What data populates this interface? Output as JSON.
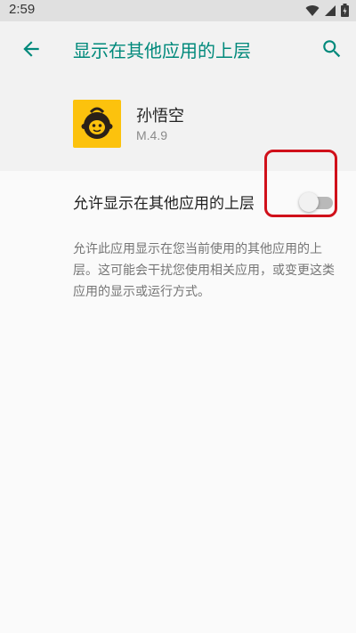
{
  "status_bar": {
    "time": "2:59",
    "icons": [
      "wifi-icon",
      "signal-icon",
      "battery-icon"
    ]
  },
  "app_bar": {
    "title": "显示在其他应用的上层",
    "back_icon": "arrow-back-icon",
    "search_icon": "search-icon"
  },
  "app_info": {
    "name": "孙悟空",
    "version": "M.4.9",
    "icon_color": "#fcc20d"
  },
  "setting": {
    "label": "允许显示在其他应用的上层",
    "enabled": false
  },
  "description": "允许此应用显示在您当前使用的其他应用的上层。这可能会干扰您使用相关应用，或变更这类应用的显示或运行方式。",
  "colors": {
    "accent": "#00897b",
    "highlight": "#d0101a"
  }
}
